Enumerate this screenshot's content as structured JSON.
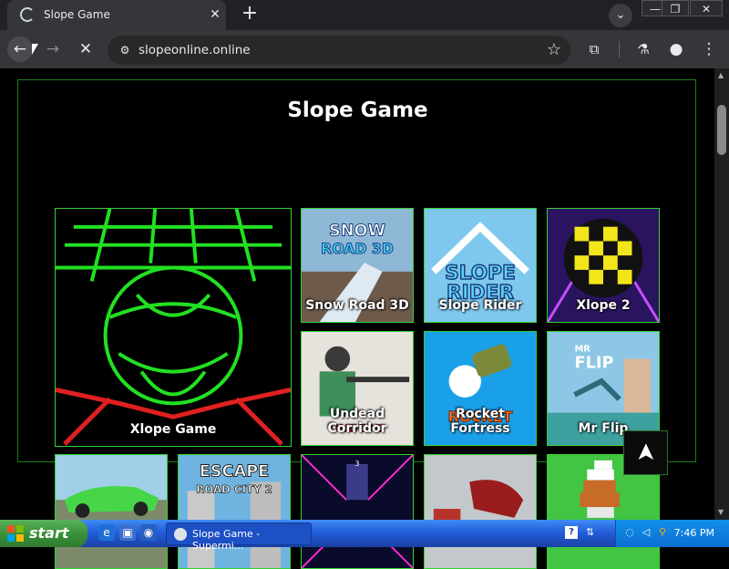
{
  "browser": {
    "tab_title": "Slope Game",
    "tab_close": "✕",
    "new_tab": "+",
    "url": "slopeonline.online"
  },
  "window_controls": {
    "minimize": "—",
    "restore": "❐",
    "close": "✕"
  },
  "page": {
    "title": "Slope Game",
    "games": [
      {
        "label": "Xlope Game"
      },
      {
        "label": "Snow Road 3D",
        "art_text": "SNOW ROAD 3D"
      },
      {
        "label": "Slope Rider",
        "art_text": "SLOPE RIDER"
      },
      {
        "label": "Xlope 2"
      },
      {
        "label": "Undead Corridor",
        "art_text": "UNDEAD CORRIDOR"
      },
      {
        "label": "Rocket Fortress",
        "art_text": "ROCKET FORTRESS"
      },
      {
        "label": "Mr Flip",
        "art_text": "MR FLIP"
      },
      {
        "label": ""
      },
      {
        "label": "",
        "art_text": "ESCAPE ROAD CITY 2"
      },
      {
        "label": "",
        "art_text": "3"
      },
      {
        "label": ""
      },
      {
        "label": ""
      }
    ],
    "back_to_top": "➤"
  },
  "taskbar": {
    "start_label": "start",
    "task_title": "Slope Game - Supermi...",
    "clock": "7:46 PM"
  },
  "colors": {
    "accent_green": "#32d232",
    "taskbar_blue": "#245edb",
    "start_green": "#3a913a"
  }
}
